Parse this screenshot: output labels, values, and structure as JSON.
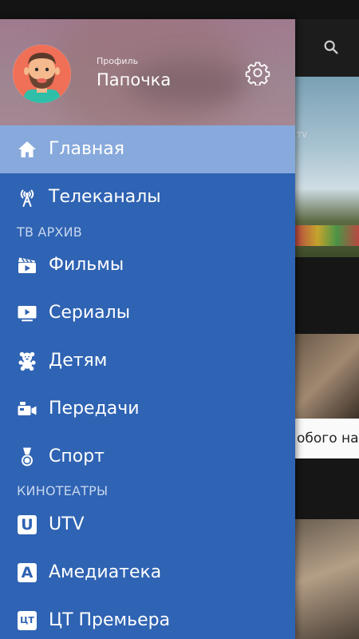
{
  "drawer": {
    "profile_caption": "Профиль",
    "profile_name": "Папочка",
    "items": [
      {
        "label": "Главная",
        "icon": "home-icon",
        "active": true
      },
      {
        "label": "Телеканалы",
        "icon": "antenna-icon"
      },
      {
        "label": "Фильмы",
        "icon": "clapperboard-icon"
      },
      {
        "label": "Сериалы",
        "icon": "tv-play-icon"
      },
      {
        "label": "Детям",
        "icon": "teddy-bear-icon"
      },
      {
        "label": "Передачи",
        "icon": "video-camera-icon"
      },
      {
        "label": "Спорт",
        "icon": "medal-icon"
      },
      {
        "label": "UTV",
        "icon": "utv-logo",
        "logo_text": "U"
      },
      {
        "label": "Амедиатека",
        "icon": "amediateka-logo",
        "logo_text": "A"
      },
      {
        "label": "ЦТ Премьера",
        "icon": "ct-premiere-logo",
        "logo_text": "ЦТ"
      }
    ],
    "sections": {
      "tv_archive": "ТВ АРХИВ",
      "cinemas": "КИНОТЕАТРЫ"
    }
  },
  "background": {
    "card1_label": "TV",
    "card2_text": "обого наз"
  },
  "colors": {
    "drawer": "#2f63b3",
    "active_item": "#87a9dc",
    "header": "#a07a8f"
  }
}
